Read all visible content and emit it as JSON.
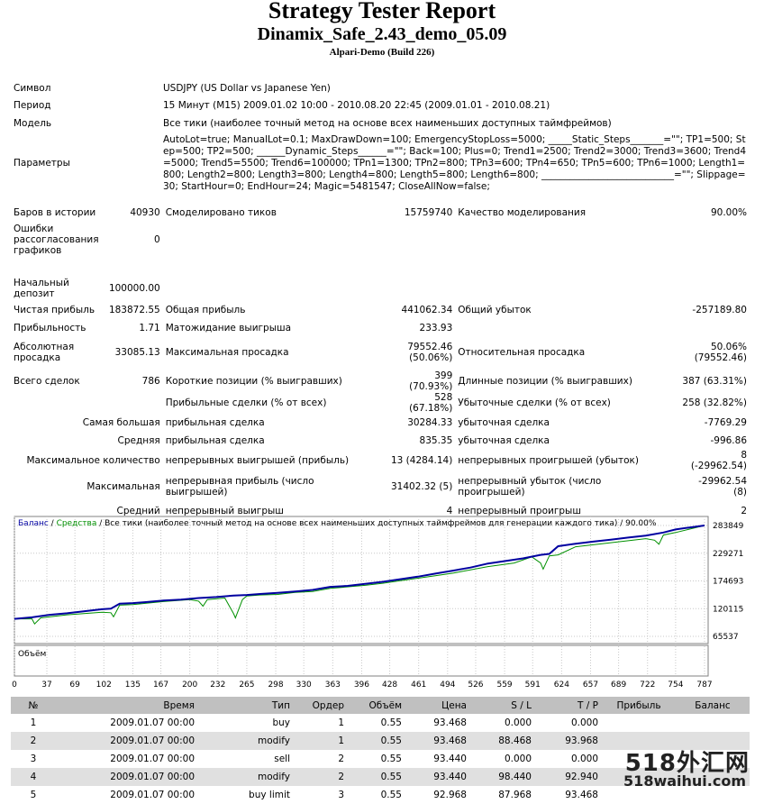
{
  "header": {
    "title": "Strategy Tester Report",
    "expert": "Dinamix_Safe_2.43_demo_05.09",
    "server": "Alpari-Demo (Build 226)"
  },
  "info": {
    "symbol_label": "Символ",
    "symbol": "USDJPY (US Dollar vs Japanese Yen)",
    "period_label": "Период",
    "period": "15 Минут (M15) 2009.01.02 10:00 - 2010.08.20 22:45 (2009.01.01 - 2010.08.21)",
    "model_label": "Модель",
    "model": "Все тики (наиболее точный метод на основе всех наименьших доступных таймфреймов)",
    "params_label": "Параметры",
    "params": "AutoLot=true; ManualLot=0.1; MaxDrawDown=100; EmergencyStopLoss=5000; _____Static_Steps_______=\"\"; TP1=500; Step=500; TP2=500; ______Dynamic_Steps______=\"\"; Back=100; Plus=0; Trend1=2500; Trend2=3000; Trend3=3600; Trend4=5000; Trend5=5500; Trend6=100000; TPn1=1300; TPn2=800; TPn3=600; TPn4=650; TPn5=600; TPn6=1000; Length1=800; Length2=800; Length3=800; Length4=800; Length5=800; Length6=800; ____________________________=\"\"; Slippage=30; StartHour=0; EndHour=24; Magic=5481547; CloseAllNow=false;"
  },
  "stats": {
    "bars_label": "Баров в истории",
    "bars": "40930",
    "ticks_label": "Смоделировано тиков",
    "ticks": "15759740",
    "quality_label": "Качество моделирования",
    "quality": "90.00%",
    "mismatch_label": "Ошибки рассогласования графиков",
    "mismatch": "0",
    "deposit_label": "Начальный депозит",
    "deposit": "100000.00",
    "net_label": "Чистая прибыль",
    "net": "183872.55",
    "gross_profit_label": "Общая прибыль",
    "gross_profit": "441062.34",
    "gross_loss_label": "Общий убыток",
    "gross_loss": "-257189.80",
    "pf_label": "Прибыльность",
    "pf": "1.71",
    "payoff_label": "Матожидание выигрыша",
    "payoff": "233.93",
    "abs_dd_label": "Абсолютная просадка",
    "abs_dd": "33085.13",
    "max_dd_label": "Максимальная просадка",
    "max_dd": "79552.46 (50.06%)",
    "rel_dd_label": "Относительная просадка",
    "rel_dd": "50.06% (79552.46)",
    "trades_label": "Всего сделок",
    "trades": "786",
    "short_label": "Короткие позиции (% выигравших)",
    "short": "399 (70.93%)",
    "long_label": "Длинные позиции (% выигравших)",
    "long": "387 (63.31%)",
    "win_label": "Прибыльные сделки (% от всех)",
    "win": "528 (67.18%)",
    "loss_label": "Убыточные сделки (% от всех)",
    "loss": "258 (32.82%)",
    "largest_label": "Самая большая",
    "largest_win_label": "прибыльная сделка",
    "largest_win": "30284.33",
    "largest_loss_label": "убыточная сделка",
    "largest_loss": "-7769.29",
    "avg_label": "Средняя",
    "avg_win_label": "прибыльная сделка",
    "avg_win": "835.35",
    "avg_loss_label": "убыточная сделка",
    "avg_loss": "-996.86",
    "maxcount_label": "Максимальное количество",
    "maxcons_win_label": "непрерывных выигрышей (прибыль)",
    "maxcons_win": "13 (4284.14)",
    "maxcons_loss_label": "непрерывных проигрышей (убыток)",
    "maxcons_loss": "8 (-29962.54)",
    "maximal_label": "Максимальная",
    "maxcons_profit_label": "непрерывная прибыль (число выигрышей)",
    "maxcons_profit": "31402.32 (5)",
    "maxcons_lossamt_label": "непрерывный убыток (число проигрышей)",
    "maxcons_lossamt": "-29962.54 (8)",
    "average_label": "Средний",
    "avgcons_win_label": "непрерывный выигрыш",
    "avgcons_win": "4",
    "avgcons_loss_label": "непрерывный проигрыш",
    "avgcons_loss": "2"
  },
  "chart_data": {
    "type": "line",
    "legend_balance": "Баланс",
    "legend_sep": " / ",
    "legend_equity": "Средства",
    "legend_rest": " / Все тики (наиболее точный метод на основе всех наименьших доступных таймфреймов для генерации каждого тика) / 90.00%",
    "volume_label": "Объём",
    "x_ticks": [
      "0",
      "37",
      "69",
      "102",
      "135",
      "167",
      "200",
      "232",
      "265",
      "298",
      "330",
      "363",
      "396",
      "428",
      "461",
      "494",
      "526",
      "559",
      "591",
      "624",
      "657",
      "689",
      "722",
      "754",
      "787"
    ],
    "y_ticks": [
      "283849",
      "229271",
      "174693",
      "120115",
      "65537"
    ],
    "ylim": [
      65537,
      283849
    ],
    "xlim": [
      0,
      787
    ],
    "colors": {
      "balance": "#0000a0",
      "equity": "#009000"
    },
    "series": [
      {
        "name": "Баланс",
        "x": [
          0,
          20,
          40,
          60,
          80,
          100,
          110,
          120,
          135,
          150,
          170,
          190,
          210,
          230,
          250,
          265,
          280,
          300,
          320,
          340,
          360,
          380,
          400,
          420,
          440,
          460,
          480,
          500,
          520,
          540,
          560,
          580,
          600,
          610,
          620,
          640,
          660,
          680,
          700,
          720,
          740,
          754,
          770,
          787
        ],
        "values": [
          100000,
          103000,
          108000,
          111000,
          115000,
          119000,
          120000,
          130000,
          131000,
          133000,
          136000,
          138000,
          141000,
          143000,
          146000,
          147000,
          149000,
          151000,
          154000,
          157000,
          163000,
          165000,
          169000,
          173000,
          178000,
          183000,
          189000,
          195000,
          201000,
          209000,
          214000,
          219000,
          226000,
          228000,
          243000,
          248000,
          252000,
          256000,
          260000,
          264000,
          270000,
          276000,
          280000,
          283849
        ]
      },
      {
        "name": "Средства",
        "x": [
          0,
          20,
          23,
          30,
          60,
          100,
          110,
          113,
          120,
          135,
          170,
          200,
          210,
          215,
          220,
          240,
          250,
          252,
          260,
          265,
          280,
          300,
          320,
          340,
          360,
          400,
          420,
          440,
          480,
          500,
          540,
          570,
          590,
          600,
          603,
          610,
          620,
          640,
          680,
          720,
          730,
          735,
          740,
          754,
          787
        ],
        "values": [
          100000,
          100000,
          90000,
          102000,
          108000,
          113000,
          112000,
          104000,
          127000,
          128000,
          134000,
          138000,
          135000,
          125000,
          138000,
          141000,
          110000,
          102000,
          138000,
          145000,
          147000,
          148000,
          152000,
          154000,
          160000,
          166000,
          170000,
          175000,
          185000,
          190000,
          203000,
          210000,
          222000,
          210000,
          198000,
          224000,
          226000,
          242000,
          250000,
          258000,
          255000,
          247000,
          265000,
          270000,
          283849
        ]
      }
    ]
  },
  "trades": {
    "headers": [
      "№",
      "Время",
      "Тип",
      "Ордер",
      "Объём",
      "Цена",
      "S / L",
      "T / P",
      "Прибыль",
      "Баланс"
    ],
    "rows": [
      [
        "1",
        "2009.01.07 00:00",
        "buy",
        "1",
        "0.55",
        "93.468",
        "0.000",
        "0.000",
        "",
        ""
      ],
      [
        "2",
        "2009.01.07 00:00",
        "modify",
        "1",
        "0.55",
        "93.468",
        "88.468",
        "93.968",
        "",
        ""
      ],
      [
        "3",
        "2009.01.07 00:00",
        "sell",
        "2",
        "0.55",
        "93.440",
        "0.000",
        "0.000",
        "",
        ""
      ],
      [
        "4",
        "2009.01.07 00:00",
        "modify",
        "2",
        "0.55",
        "93.440",
        "98.440",
        "92.940",
        "",
        ""
      ],
      [
        "5",
        "2009.01.07 00:00",
        "buy limit",
        "3",
        "0.55",
        "92.968",
        "87.968",
        "93.468",
        "",
        ""
      ]
    ]
  },
  "watermark": {
    "big": "518外汇网",
    "small": "518waihui.com"
  }
}
